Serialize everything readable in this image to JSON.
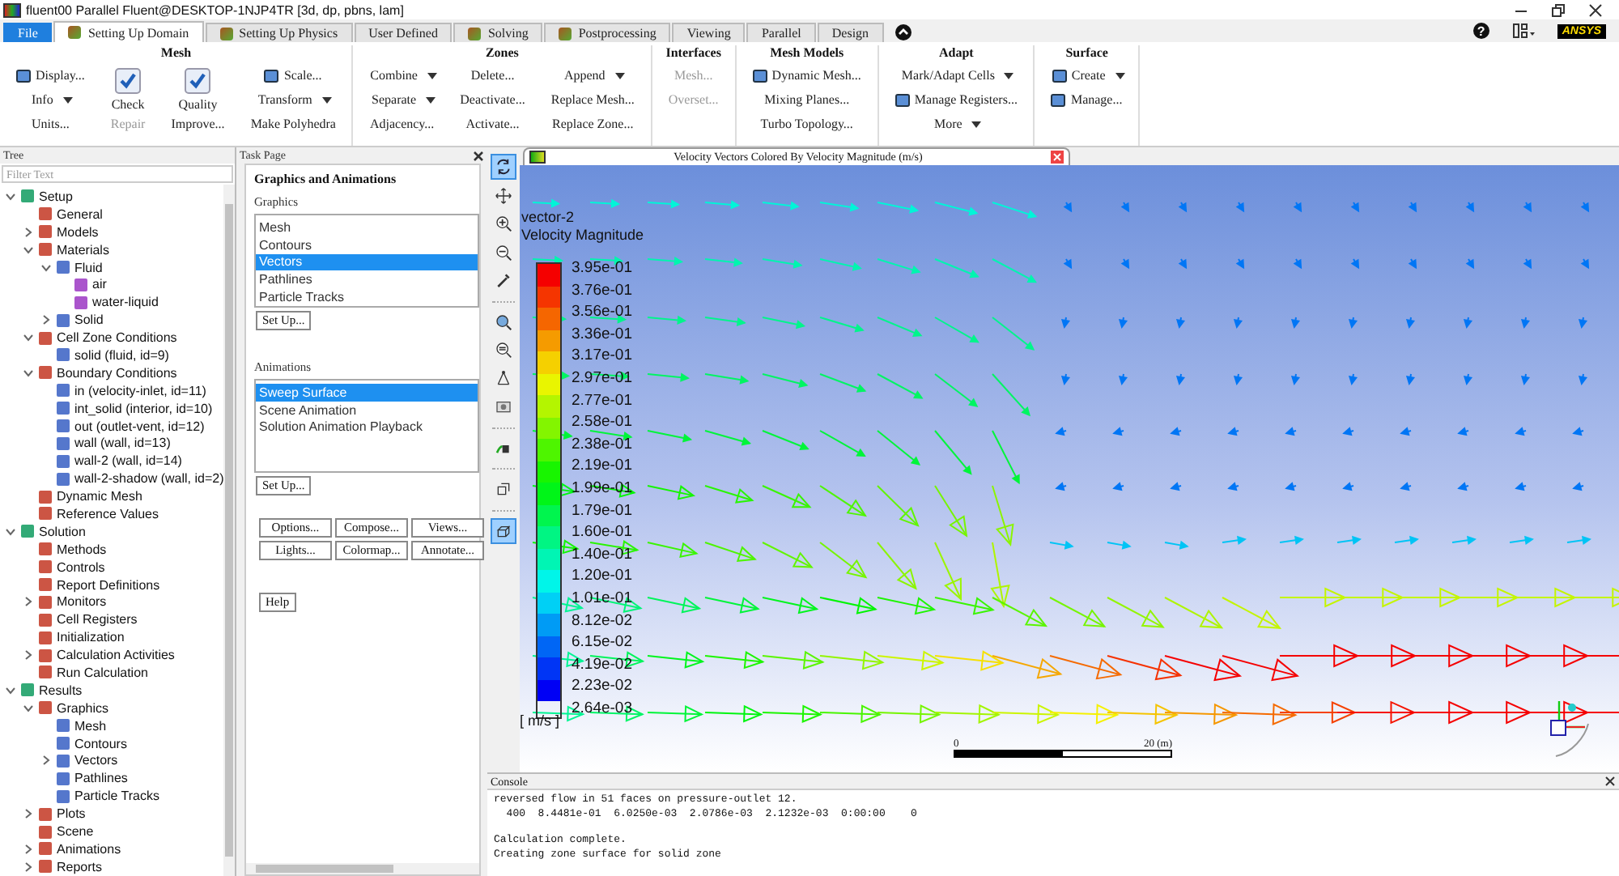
{
  "window": {
    "title": "fluent00 Parallel Fluent@DESKTOP-1NJP4TR  [3d, dp, pbns, lam]",
    "help": "?",
    "logo": "ANSYS"
  },
  "tabs": [
    {
      "label": "File",
      "kind": "file",
      "selected": false
    },
    {
      "label": "Setting Up Domain",
      "kind": "icon",
      "selected": true
    },
    {
      "label": "Setting Up Physics",
      "kind": "icon",
      "selected": false
    },
    {
      "label": "User Defined",
      "kind": "plain",
      "selected": false
    },
    {
      "label": "Solving",
      "kind": "icon",
      "selected": false
    },
    {
      "label": "Postprocessing",
      "kind": "icon",
      "selected": false
    },
    {
      "label": "Viewing",
      "kind": "plain",
      "selected": false
    },
    {
      "label": "Parallel",
      "kind": "plain",
      "selected": false
    },
    {
      "label": "Design",
      "kind": "plain",
      "selected": false
    }
  ],
  "ribbon": [
    {
      "title": "Mesh",
      "columns": [
        [
          {
            "label": "Display...",
            "kind": "icon"
          },
          {
            "label": "Info",
            "kind": "text",
            "dropdown": true
          },
          {
            "label": "Units...",
            "kind": "text"
          }
        ],
        [
          {
            "label": "Check",
            "kind": "large"
          },
          {
            "label": "Repair",
            "kind": "text",
            "disabled": true
          }
        ],
        [
          {
            "label": "Quality",
            "kind": "large"
          },
          {
            "label": "Improve...",
            "kind": "text"
          }
        ],
        [
          {
            "label": "Scale...",
            "kind": "icon"
          },
          {
            "label": "Transform",
            "kind": "text",
            "dropdown": true
          },
          {
            "label": "Make Polyhedra",
            "kind": "text"
          }
        ]
      ]
    },
    {
      "title": "Zones",
      "columns": [
        [
          {
            "label": "Combine",
            "kind": "text",
            "dropdown": true
          },
          {
            "label": "Separate",
            "kind": "text",
            "dropdown": true
          },
          {
            "label": "Adjacency...",
            "kind": "text"
          }
        ],
        [
          {
            "label": "Delete...",
            "kind": "text"
          },
          {
            "label": "Deactivate...",
            "kind": "text"
          },
          {
            "label": "Activate...",
            "kind": "text"
          }
        ],
        [
          {
            "label": "Append",
            "kind": "text",
            "dropdown": true
          },
          {
            "label": "Replace Mesh...",
            "kind": "text"
          },
          {
            "label": "Replace Zone...",
            "kind": "text"
          }
        ]
      ]
    },
    {
      "title": "Interfaces",
      "columns": [
        [
          {
            "label": "Mesh...",
            "kind": "text",
            "disabled": true
          },
          {
            "label": "Overset...",
            "kind": "text",
            "disabled": true
          }
        ]
      ]
    },
    {
      "title": "Mesh Models",
      "columns": [
        [
          {
            "label": "Dynamic Mesh...",
            "kind": "icon"
          },
          {
            "label": "Mixing Planes...",
            "kind": "text"
          },
          {
            "label": "Turbo Topology...",
            "kind": "text"
          }
        ]
      ]
    },
    {
      "title": "Adapt",
      "columns": [
        [
          {
            "label": "Mark/Adapt Cells",
            "kind": "text",
            "dropdown": true
          },
          {
            "label": "Manage Registers...",
            "kind": "icon"
          },
          {
            "label": "More",
            "kind": "text",
            "dropdown": true
          }
        ]
      ]
    },
    {
      "title": "Surface",
      "columns": [
        [
          {
            "label": "Create",
            "kind": "icon",
            "dropdown": true
          },
          {
            "label": "Manage...",
            "kind": "icon"
          }
        ]
      ]
    }
  ],
  "tree": {
    "title": "Tree",
    "filter": {
      "placeholder": "Filter Text"
    },
    "items": [
      {
        "label": "Setup",
        "expanded": true,
        "children": [
          {
            "label": "General"
          },
          {
            "label": "Models",
            "expanded": false
          },
          {
            "label": "Materials",
            "expanded": true,
            "children": [
              {
                "label": "Fluid",
                "expanded": true,
                "children": [
                  {
                    "label": "air"
                  },
                  {
                    "label": "water-liquid"
                  }
                ]
              },
              {
                "label": "Solid",
                "expanded": false
              }
            ]
          },
          {
            "label": "Cell Zone Conditions",
            "expanded": true,
            "children": [
              {
                "label": "solid (fluid, id=9)"
              }
            ]
          },
          {
            "label": "Boundary Conditions",
            "expanded": true,
            "children": [
              {
                "label": "in (velocity-inlet, id=11)"
              },
              {
                "label": "int_solid (interior, id=10)"
              },
              {
                "label": "out (outlet-vent, id=12)"
              },
              {
                "label": "wall (wall, id=13)"
              },
              {
                "label": "wall-2 (wall, id=14)"
              },
              {
                "label": "wall-2-shadow (wall, id=2)"
              }
            ]
          },
          {
            "label": "Dynamic Mesh"
          },
          {
            "label": "Reference Values"
          }
        ]
      },
      {
        "label": "Solution",
        "expanded": true,
        "children": [
          {
            "label": "Methods"
          },
          {
            "label": "Controls"
          },
          {
            "label": "Report Definitions"
          },
          {
            "label": "Monitors",
            "expanded": false
          },
          {
            "label": "Cell Registers"
          },
          {
            "label": "Initialization"
          },
          {
            "label": "Calculation Activities",
            "expanded": false
          },
          {
            "label": "Run Calculation"
          }
        ]
      },
      {
        "label": "Results",
        "expanded": true,
        "children": [
          {
            "label": "Graphics",
            "expanded": true,
            "children": [
              {
                "label": "Mesh"
              },
              {
                "label": "Contours"
              },
              {
                "label": "Vectors",
                "expanded": false
              },
              {
                "label": "Pathlines"
              },
              {
                "label": "Particle Tracks"
              }
            ]
          },
          {
            "label": "Plots",
            "expanded": false
          },
          {
            "label": "Scene"
          },
          {
            "label": "Animations",
            "expanded": false
          },
          {
            "label": "Reports",
            "expanded": false
          }
        ]
      }
    ]
  },
  "task_page": {
    "title": "Task Page",
    "heading": "Graphics and Animations",
    "graphics_label": "Graphics",
    "graphics_items": [
      {
        "label": "Mesh",
        "selected": false
      },
      {
        "label": "Contours",
        "selected": false
      },
      {
        "label": "Vectors",
        "selected": true
      },
      {
        "label": "Pathlines",
        "selected": false
      },
      {
        "label": "Particle Tracks",
        "selected": false
      }
    ],
    "graphics_button": "Set Up...",
    "animations_label": "Animations",
    "animation_items": [
      {
        "label": "Sweep Surface",
        "selected": true
      },
      {
        "label": "Scene Animation",
        "selected": false
      },
      {
        "label": "Solution Animation Playback",
        "selected": false
      }
    ],
    "animations_button": "Set Up...",
    "buttons": [
      "Options...",
      "Compose...",
      "Views...",
      "Lights...",
      "Colormap...",
      "Annotate..."
    ],
    "help_button": "Help"
  },
  "toolbar": [
    {
      "selected": true
    },
    {
      "selected": false
    },
    {
      "selected": false
    },
    {
      "selected": false
    },
    {
      "selected": false
    },
    {
      "selected": false
    },
    {
      "selected": false
    },
    {
      "selected": false
    },
    {
      "selected": false
    },
    {
      "selected": false
    },
    {
      "selected": false
    },
    {
      "selected": true
    }
  ],
  "graphics": {
    "title": "Velocity Vectors Colored By Velocity Magnitude (m/s)",
    "legend": {
      "name": "vector-2",
      "quantity": "Velocity Magnitude",
      "labels": [
        "3.95e-01",
        "3.76e-01",
        "3.56e-01",
        "3.36e-01",
        "3.17e-01",
        "2.97e-01",
        "2.77e-01",
        "2.58e-01",
        "2.38e-01",
        "2.19e-01",
        "1.99e-01",
        "1.79e-01",
        "1.60e-01",
        "1.40e-01",
        "1.20e-01",
        "1.01e-01",
        "8.12e-02",
        "6.15e-02",
        "4.19e-02",
        "2.23e-02",
        "2.64e-03"
      ],
      "unit": "[ m/s ]"
    },
    "scale": {
      "start": "0",
      "end": "20 (m)"
    }
  },
  "console": {
    "title": "Console",
    "blocks": [
      [
        "reversed flow in 51 faces on pressure-outlet 12.",
        "  400  8.4481e-01  6.0250e-03  2.0786e-03  2.1232e-03  0:00:00    0"
      ],
      [
        "Calculation complete.",
        "Creating zone surface for solid zone"
      ]
    ]
  }
}
